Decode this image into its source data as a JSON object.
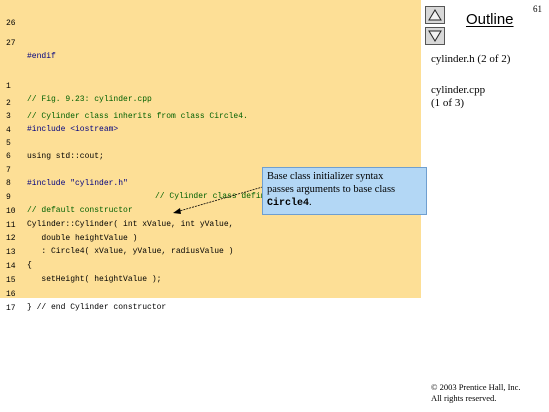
{
  "slide_number": "61",
  "nav": {
    "up_icon": "triangle-up-icon",
    "down_icon": "triangle-down-icon"
  },
  "sidebar": {
    "outline_label": "Outline",
    "item1": "cylinder.h (2 of 2)",
    "item2_line1": "cylinder.cpp",
    "item2_line2": "(1 of 3)"
  },
  "code": [
    {
      "n": "26",
      "t": ""
    },
    {
      "n": "27",
      "t": "#endif"
    },
    {
      "n": "1",
      "t": "// Fig. 9.23: cylinder.cpp"
    },
    {
      "n": "2",
      "t": "// Cylinder class inherits from class Circle4."
    },
    {
      "n": "3",
      "t": "#include <iostream>"
    },
    {
      "n": "4",
      "t": ""
    },
    {
      "n": "5",
      "t": "using std::cout;"
    },
    {
      "n": "6",
      "t": ""
    },
    {
      "n": "7a",
      "t": "#include \"cylinder.h\""
    },
    {
      "n": "7b",
      "t": "// Cylinder class definition"
    },
    {
      "n": "8",
      "t": ""
    },
    {
      "n": "9",
      "t": "// default constructor"
    },
    {
      "n": "10",
      "t": "Cylinder::Cylinder( int xValue, int yValue,"
    },
    {
      "n": "11",
      "t": "   double heightValue )"
    },
    {
      "n": "12",
      "t": "   : Circle4( xValue, yValue, radiusValue )"
    },
    {
      "n": "13",
      "t": "{"
    },
    {
      "n": "14",
      "t": "   setHeight( heightValue );"
    },
    {
      "n": "15",
      "t": ""
    },
    {
      "n": "16",
      "t": "} // end Cylinder constructor"
    },
    {
      "n": "17",
      "t": ""
    }
  ],
  "line_numbers": [
    "26",
    "27",
    "1",
    "2",
    "3",
    "4",
    "5",
    "6",
    "7",
    "8",
    "9",
    "10",
    "11",
    "12",
    "13",
    "14",
    "15",
    "16",
    "17"
  ],
  "callout": {
    "line1": "Base class initializer syntax",
    "line2": "passes arguments to base class",
    "line3_code": "Circle4",
    "line3_end": "."
  },
  "copyright": {
    "line1": "© 2003 Prentice Hall, Inc.",
    "line2": "All rights reserved."
  },
  "colors": {
    "code_bg": "#fddf96",
    "callout_bg": "#b3d7f5",
    "comment": "#006000",
    "string": "#0000c0"
  }
}
